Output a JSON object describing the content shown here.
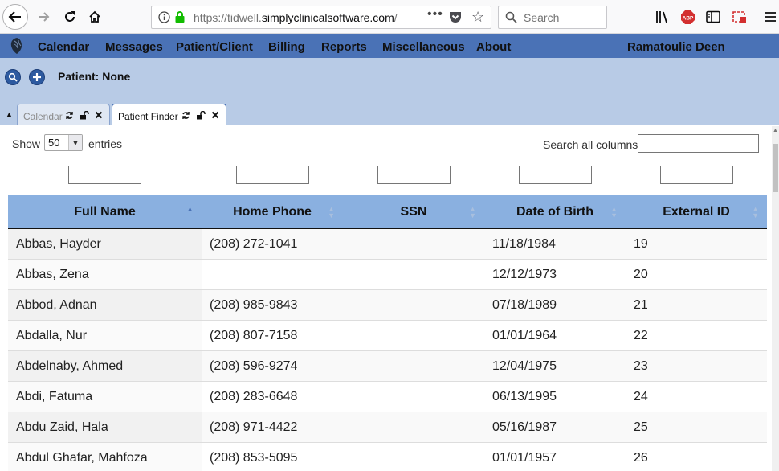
{
  "browser": {
    "url_prefix": "https://tidwell.",
    "url_host": "simplyclinicalsoftware.com",
    "url_suffix": "/",
    "search_placeholder": "Search",
    "adblock_label": "ABP"
  },
  "menu": {
    "items": [
      "Calendar",
      "Messages",
      "Patient/Client",
      "Billing",
      "Reports",
      "Miscellaneous",
      "About"
    ],
    "user": "Ramatoulie Deen"
  },
  "patient": {
    "label": "Patient: None"
  },
  "tabs": [
    {
      "label": "Calendar",
      "active": false
    },
    {
      "label": "Patient Finder",
      "active": true
    }
  ],
  "table_controls": {
    "show_label": "Show",
    "entries_value": "50",
    "entries_label": "entries",
    "search_label": "Search all columns:"
  },
  "table": {
    "columns": [
      "Full Name",
      "Home Phone",
      "SSN",
      "Date of Birth",
      "External ID"
    ],
    "sorted_column": "Full Name",
    "rows": [
      [
        "Abbas, Hayder",
        "(208) 272-1041",
        "",
        "11/18/1984",
        "19"
      ],
      [
        "Abbas, Zena",
        "",
        "",
        "12/12/1973",
        "20"
      ],
      [
        "Abbod, Adnan",
        "(208) 985-9843",
        "",
        "07/18/1989",
        "21"
      ],
      [
        "Abdalla, Nur",
        "(208) 807-7158",
        "",
        "01/01/1964",
        "22"
      ],
      [
        "Abdelnaby, Ahmed",
        "(208) 596-9274",
        "",
        "12/04/1975",
        "23"
      ],
      [
        "Abdi, Fatuma",
        "(208) 283-6648",
        "",
        "06/13/1995",
        "24"
      ],
      [
        "Abdu Zaid, Hala",
        "(208) 971-4422",
        "",
        "05/16/1987",
        "25"
      ],
      [
        "Abdul Ghafar, Mahfoza",
        "(208) 853-5095",
        "",
        "01/01/1957",
        "26"
      ]
    ]
  },
  "colors": {
    "menubar": "#4a72b6",
    "patient_area": "#b8cbe6",
    "table_header": "#8ab0e0"
  }
}
